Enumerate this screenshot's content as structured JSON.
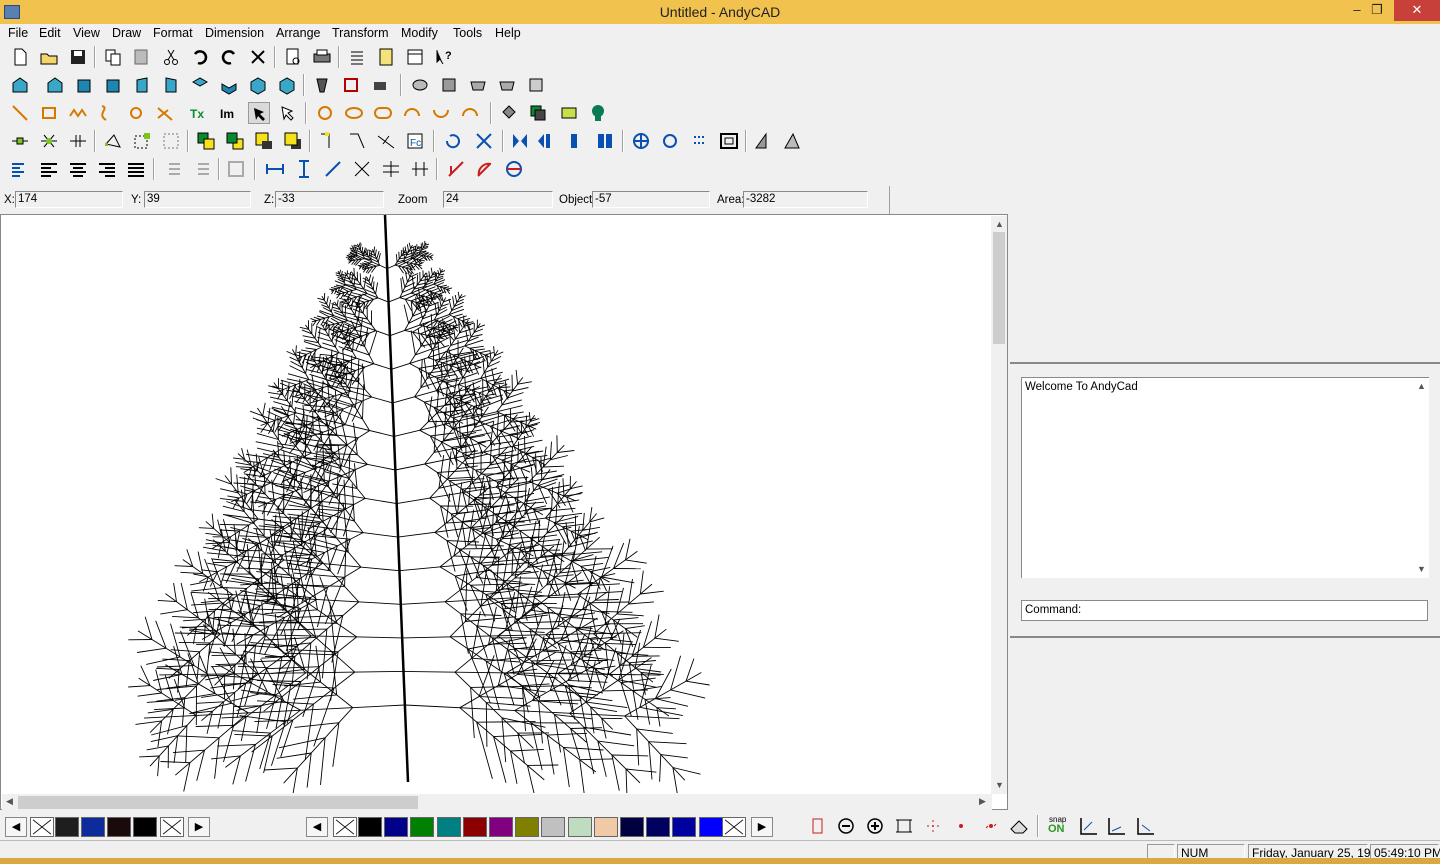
{
  "window": {
    "title": "Untitled - AndyCAD",
    "minimize": "–",
    "restore": "❐",
    "close": "✕"
  },
  "menu": [
    "File",
    "Edit",
    "View",
    "Draw",
    "Format",
    "Dimension",
    "Arrange",
    "Transform",
    "Modify",
    "Tools",
    "Help"
  ],
  "coords": {
    "x_label": "X:",
    "x_value": "174",
    "y_label": "Y:",
    "y_value": "39",
    "z_label": "Z:",
    "z_value": "-33",
    "zoom_label": "Zoom",
    "zoom_value": "24",
    "object_label": "Object",
    "object_value": "-57",
    "area_label": "Area:",
    "area_value": "-3282"
  },
  "console": {
    "message": "Welcome To AndyCad",
    "command_label": "Command:"
  },
  "palette_left": [
    "#000000",
    "#1e1e1e",
    "#0b2c9a",
    "#1a0a0a",
    "#000000"
  ],
  "palette_main": [
    "#000000",
    "#00008b",
    "#008000",
    "#008080",
    "#8b0000",
    "#800080",
    "#808000",
    "#c0c0c0",
    "#c0dcc0",
    "#f0caa6",
    "#000040",
    "#000060",
    "#0000a0",
    "#0000ff"
  ],
  "snap_label": "snap",
  "snap_state": "ON",
  "status": {
    "num": "NUM",
    "date": "Friday, January 25, 19",
    "time": "05:49:10 PM"
  },
  "colors": {
    "titlebar": "#f2c24e",
    "close": "#c7403a"
  }
}
